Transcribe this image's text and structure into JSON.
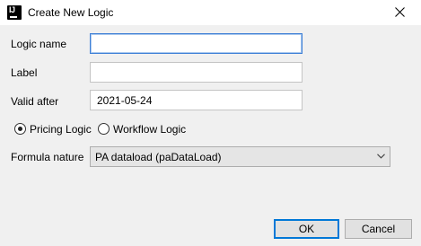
{
  "window": {
    "title": "Create New Logic",
    "app_icon": "intellij-icon",
    "app_icon_text": "IJ",
    "close_icon": "close-icon"
  },
  "form": {
    "logic_name": {
      "label": "Logic name",
      "value": ""
    },
    "label": {
      "label": "Label",
      "value": ""
    },
    "valid_after": {
      "label": "Valid after",
      "value": "2021-05-24"
    }
  },
  "logic_type": {
    "options": [
      {
        "label": "Pricing Logic",
        "selected": true
      },
      {
        "label": "Workflow Logic",
        "selected": false
      }
    ]
  },
  "formula_nature": {
    "label": "Formula nature",
    "selected": "PA dataload (paDataLoad)"
  },
  "buttons": {
    "ok": "OK",
    "cancel": "Cancel"
  },
  "colors": {
    "focus_border": "#3d7fd6",
    "default_button_border": "#0078d7",
    "dialog_background": "#f0f0f0"
  }
}
